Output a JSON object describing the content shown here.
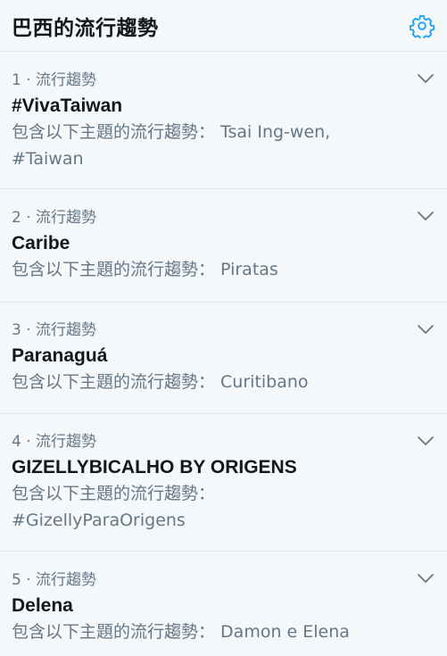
{
  "header": {
    "title": "巴西的流行趨勢",
    "settings_icon": "gear-icon",
    "accent_color": "#1da1f2"
  },
  "trends": [
    {
      "meta": "1 · 流行趨勢",
      "name": "#VivaTaiwan",
      "desc_line1": "包含以下主題的流行趨勢： Tsai Ing-wen,",
      "desc_line2": "#Taiwan"
    },
    {
      "meta": "2 · 流行趨勢",
      "name": "Caribe",
      "desc_line1": "包含以下主題的流行趨勢： Piratas"
    },
    {
      "meta": "3 · 流行趨勢",
      "name": "Paranaguá",
      "desc_line1": "包含以下主題的流行趨勢： Curitibano"
    },
    {
      "meta": "4 · 流行趨勢",
      "name": "GIZELLYBICALHO BY ORIGENS",
      "desc_line1": "包含以下主題的流行趨勢：",
      "desc_line2": "#GizellyParaOrigens"
    },
    {
      "meta": "5 · 流行趨勢",
      "name": "Delena",
      "desc_line1": "包含以下主題的流行趨勢： Damon e Elena"
    }
  ]
}
